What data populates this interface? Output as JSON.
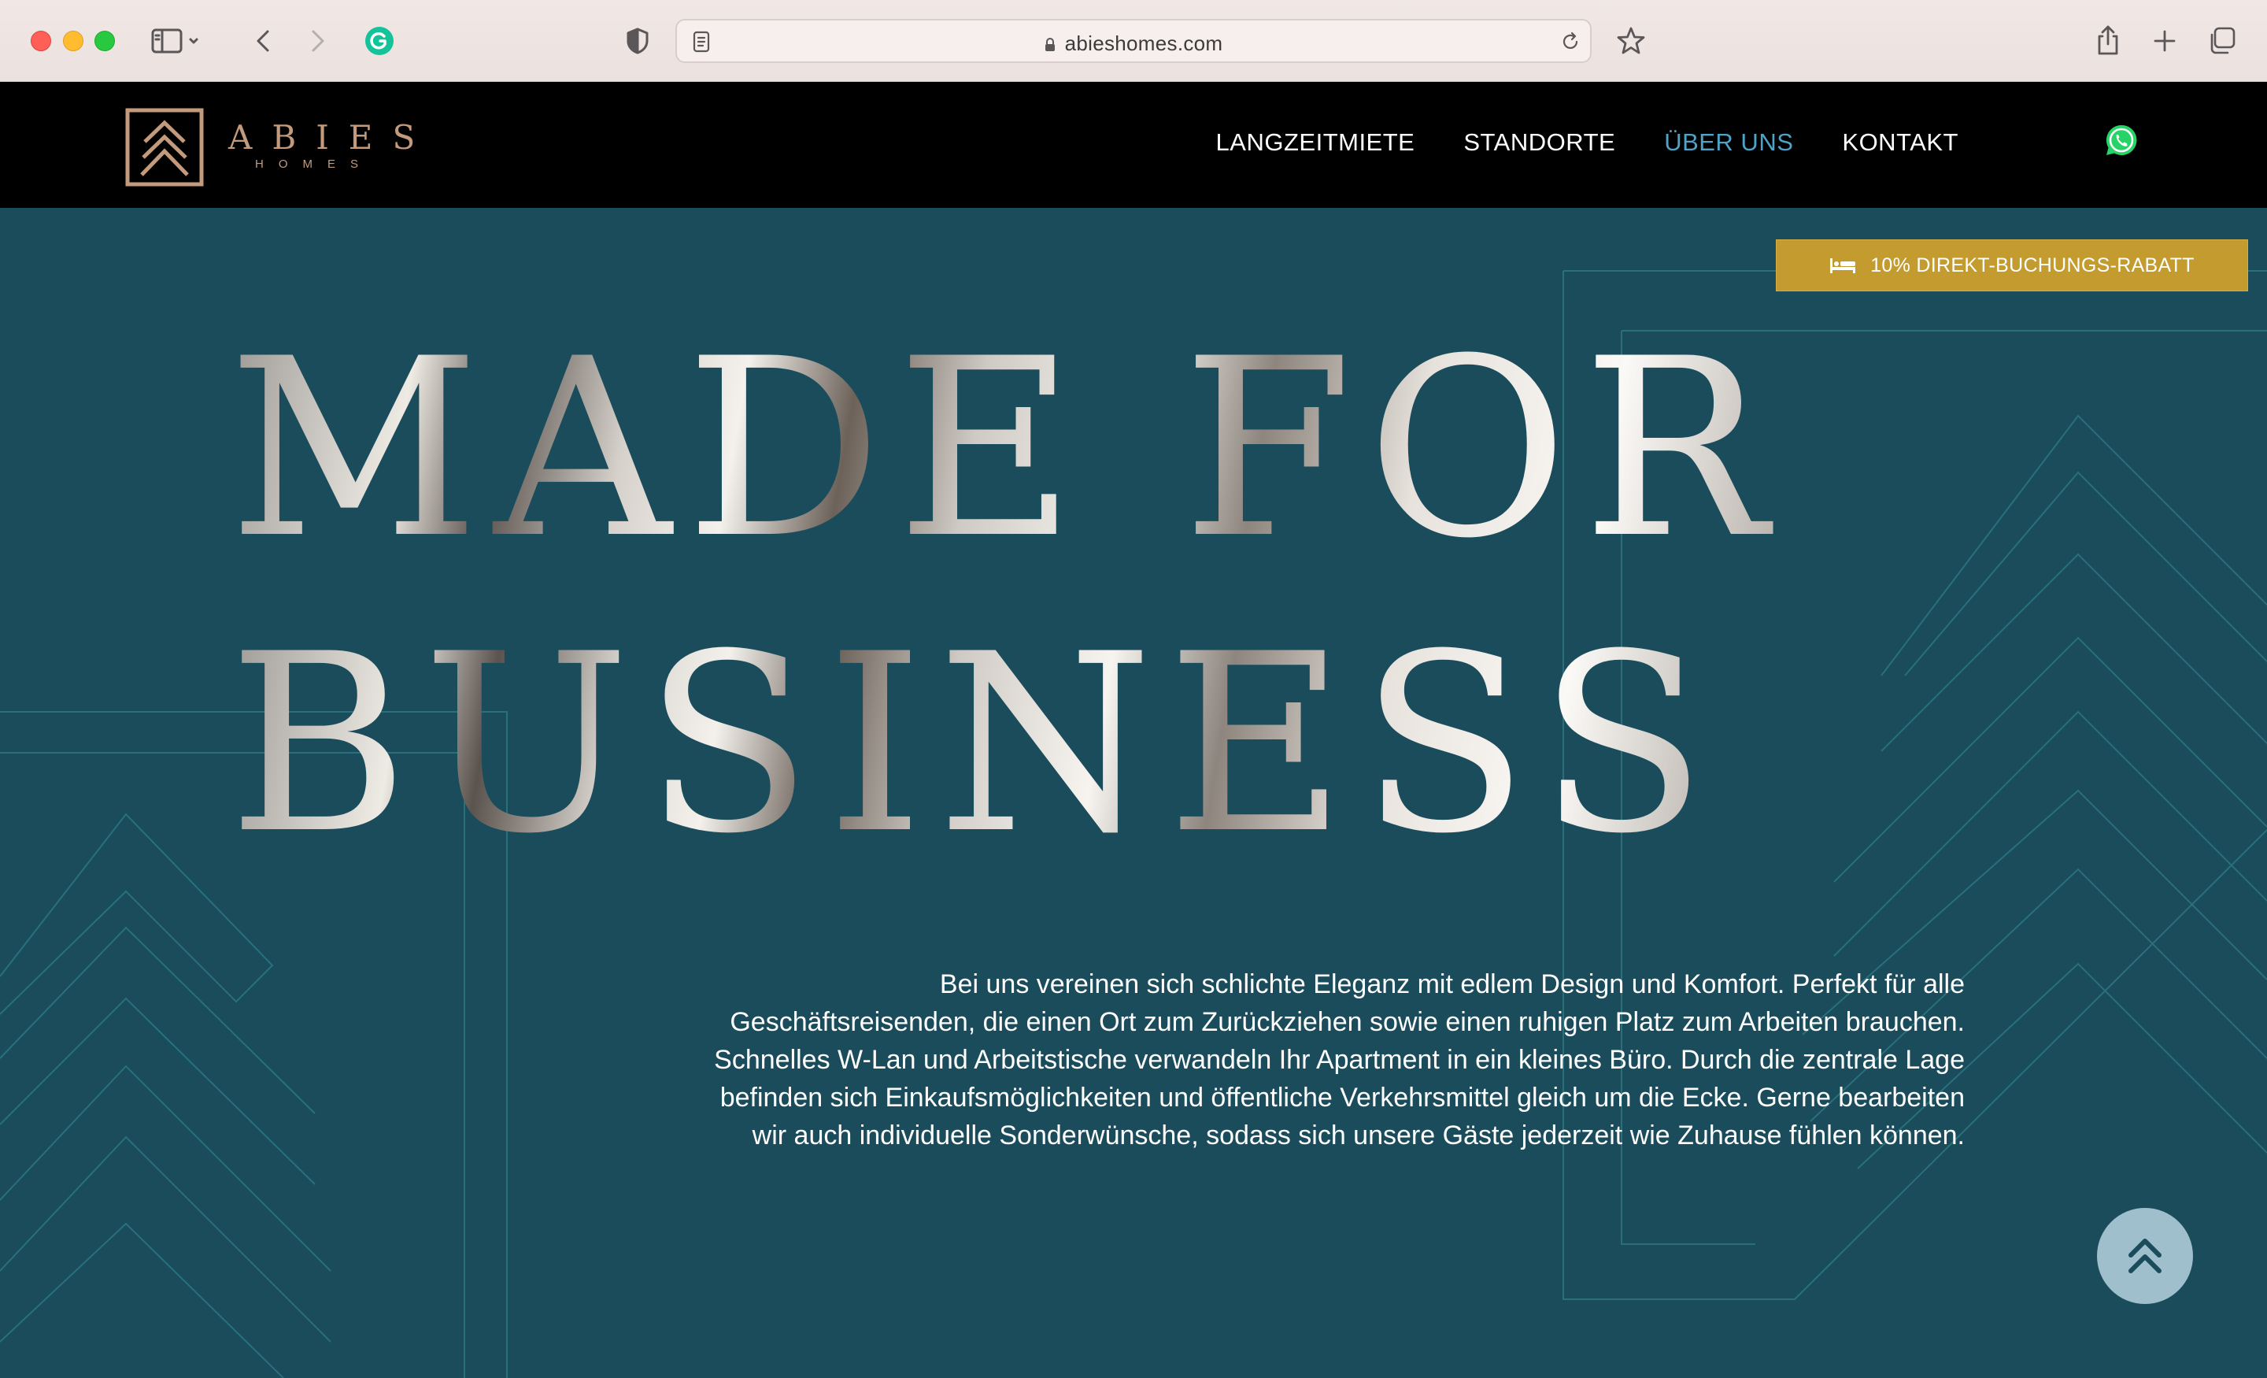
{
  "browser": {
    "url": "abieshomes.com"
  },
  "logo": {
    "word": "ABIES",
    "sub": "HOMES"
  },
  "nav": {
    "items": [
      {
        "label": "LANGZEITMIETE",
        "active": false
      },
      {
        "label": "STANDORTE",
        "active": false
      },
      {
        "label": "ÜBER UNS",
        "active": true
      },
      {
        "label": "KONTAKT",
        "active": false
      }
    ]
  },
  "hero": {
    "headline_line1": "MADE FOR",
    "headline_line2": "BUSINESS",
    "promo_label": "10% DIREKT-BUCHUNGS-RABATT",
    "intro": "Bei uns vereinen sich schlichte Eleganz mit edlem Design und Komfort. Perfekt für alle Geschäftsreisenden, die einen Ort zum Zurückziehen sowie einen ruhigen Platz zum Arbeiten brauchen. Schnelles W-Lan und Arbeitstische verwandeln Ihr Apartment in ein kleines Büro. Durch die zentrale Lage befinden sich Einkaufsmöglichkeiten und öffentliche Verkehrsmittel gleich um die Ecke. Gerne bearbeiten wir auch individuelle Sonderwünsche, sodass sich unsere Gäste jederzeit wie Zuhause fühlen können."
  },
  "colors": {
    "hero_bg": "#1a4c5c",
    "header_bg": "#000000",
    "accent_gold": "#c39b2e",
    "logo_copper": "#c49a7c",
    "nav_active": "#4ea3c6"
  },
  "icons": {
    "sidebar": "sidebar-icon",
    "back": "chevron-left-icon",
    "forward": "chevron-right-icon",
    "grammarly": "grammarly-icon",
    "shield": "shield-icon",
    "reader": "reader-icon",
    "reload": "reload-icon",
    "bookmark": "star-icon",
    "share": "share-icon",
    "new_tab": "plus-icon",
    "tabs": "tabs-overview-icon",
    "whatsapp": "whatsapp-icon",
    "bed": "bed-icon",
    "scroll_top": "double-chevron-up-icon"
  }
}
